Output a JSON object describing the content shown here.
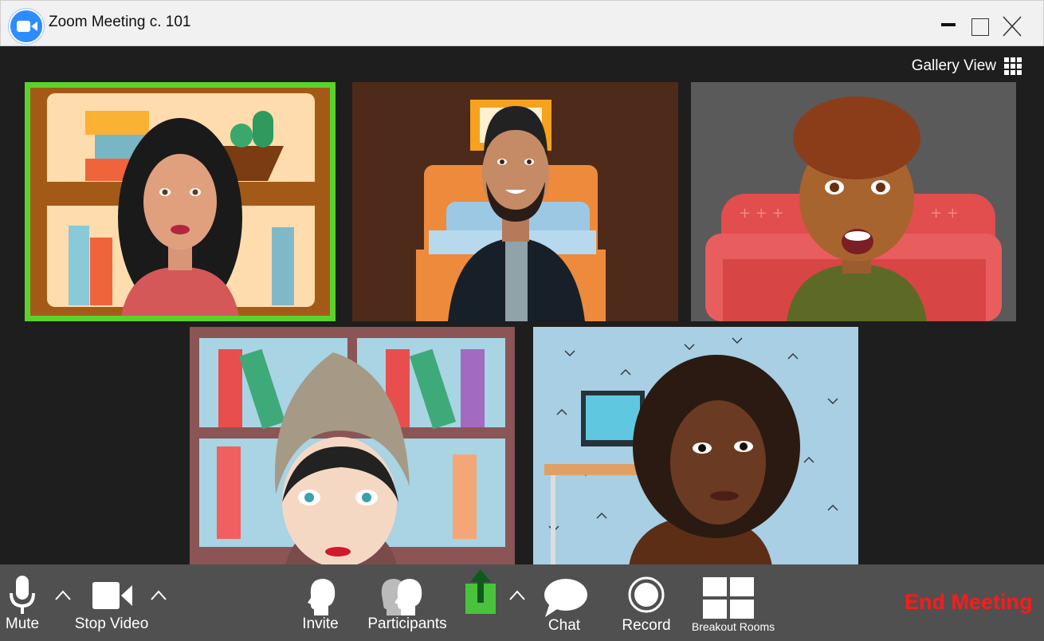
{
  "window": {
    "title": "Zoom Meeting c. 101"
  },
  "view": {
    "label": "Gallery View"
  },
  "toolbar": {
    "mute": "Mute",
    "stop_video": "Stop Video",
    "invite": "Invite",
    "participants": "Participants",
    "chat": "Chat",
    "record": "Record",
    "breakout": "Breakout Rooms",
    "end": "End Meeting"
  },
  "colors": {
    "active_speaker": "#5ad22c",
    "end_meeting": "#ff1a1a",
    "toolbar_bg": "#505050",
    "brand": "#2d8cff"
  },
  "icons": [
    "zoom-logo-icon",
    "minimize-icon",
    "maximize-icon",
    "close-icon",
    "gallery-grid-icon",
    "microphone-icon",
    "camera-icon",
    "chevron-up-icon",
    "invite-icon",
    "participants-icon",
    "share-screen-icon",
    "chat-icon",
    "record-icon",
    "breakout-rooms-icon"
  ]
}
